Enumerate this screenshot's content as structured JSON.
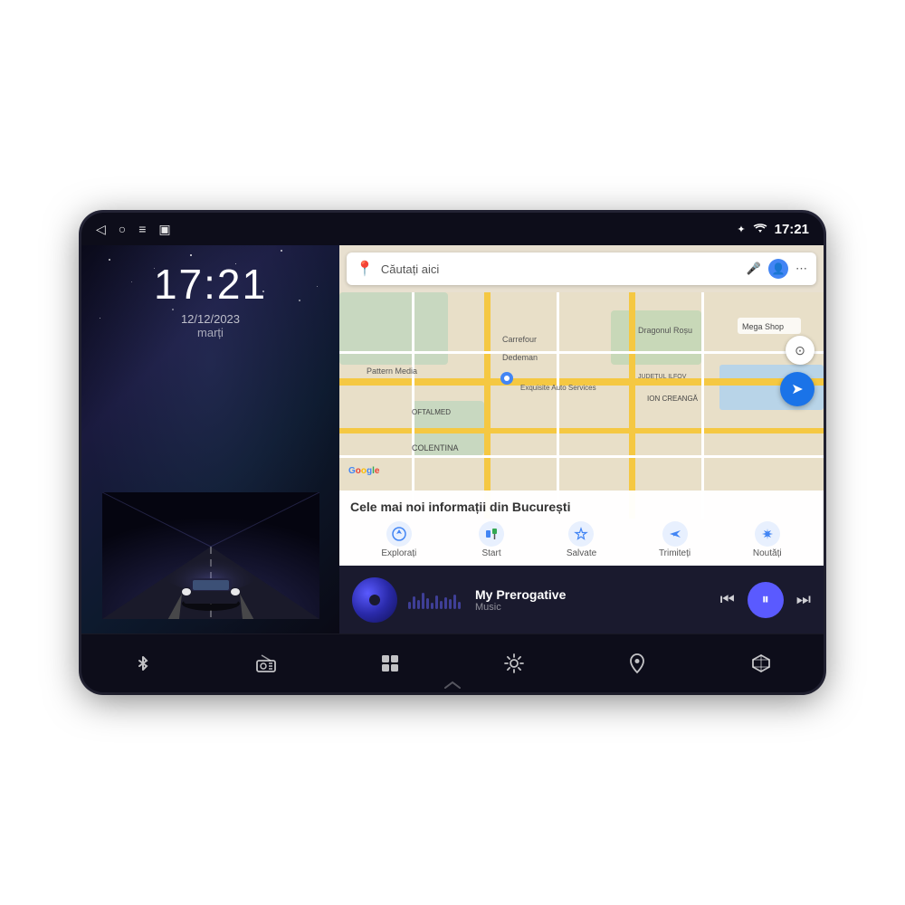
{
  "device": {
    "status_bar": {
      "back_icon": "◁",
      "circle_icon": "○",
      "menu_icon": "≡",
      "screenshot_icon": "▣",
      "bluetooth_icon": "✦",
      "wifi_icon": "WiFi",
      "time": "17:21"
    },
    "left_panel": {
      "clock_time": "17:21",
      "clock_date": "12/12/2023",
      "clock_day": "marți"
    },
    "maps": {
      "search_placeholder": "Căutați aici",
      "info_title": "Cele mai noi informații din București",
      "nav_items": [
        {
          "icon": "🧭",
          "label": "Explorați"
        },
        {
          "icon": "🚌",
          "label": "Start"
        },
        {
          "icon": "🔖",
          "label": "Salvate"
        },
        {
          "icon": "↗",
          "label": "Trimiteți"
        },
        {
          "icon": "🔔",
          "label": "Noutăți"
        }
      ]
    },
    "music": {
      "title": "My Prerogative",
      "subtitle": "Music",
      "prev_icon": "⏮",
      "play_icon": "⏸",
      "next_icon": "⏭"
    },
    "bottom_nav": [
      {
        "icon": "bluetooth",
        "label": ""
      },
      {
        "icon": "radio",
        "label": ""
      },
      {
        "icon": "apps",
        "label": ""
      },
      {
        "icon": "settings",
        "label": ""
      },
      {
        "icon": "maps",
        "label": ""
      },
      {
        "icon": "cube",
        "label": ""
      }
    ]
  }
}
